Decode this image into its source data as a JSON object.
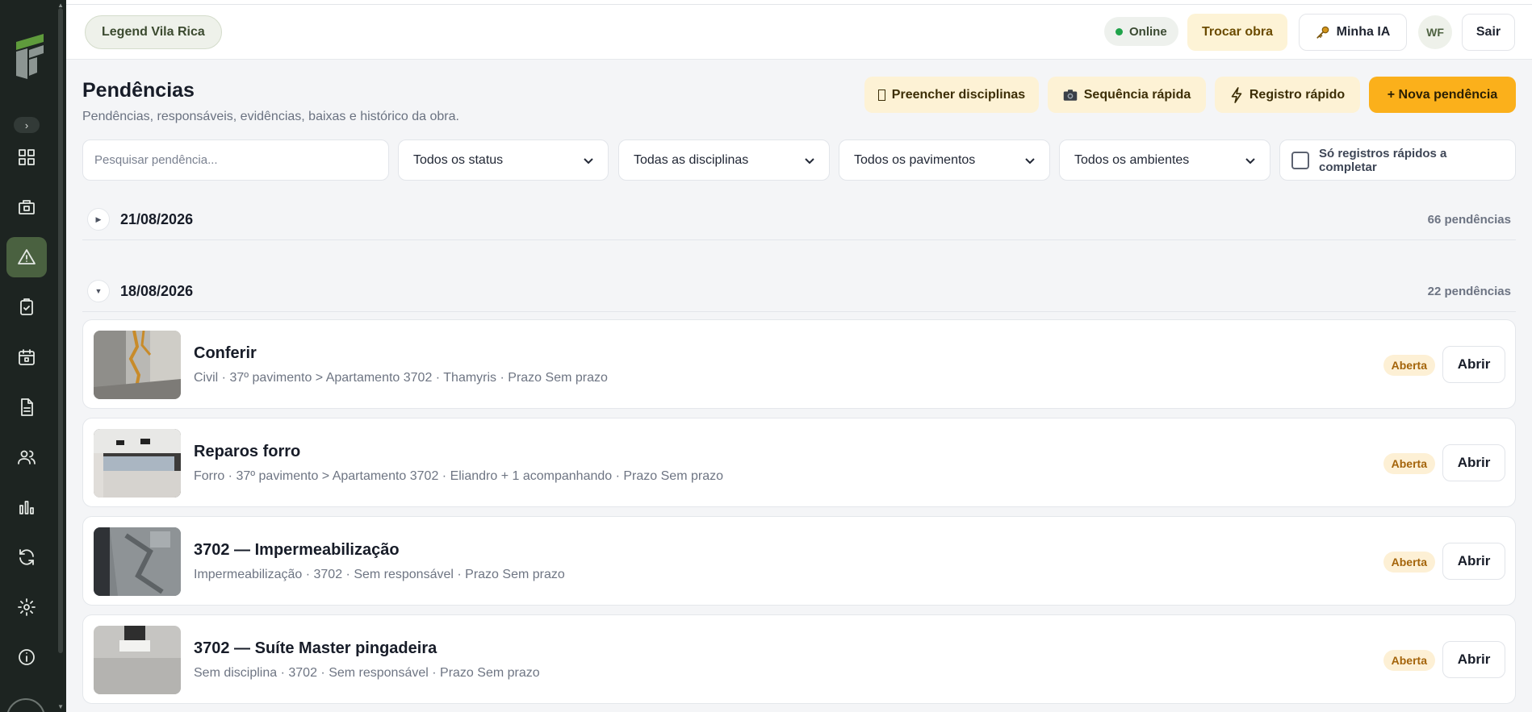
{
  "header": {
    "project": "Legend Vila Rica",
    "status": "Online",
    "switch_label": "Trocar obra",
    "ai_label": "Minha IA",
    "avatar_initials": "WF",
    "logout_label": "Sair"
  },
  "page": {
    "title": "Pendências",
    "subtitle": "Pendências, responsáveis, evidências, baixas e histórico da obra."
  },
  "actions": {
    "fill_disciplines": "Preencher disciplinas",
    "quick_sequence": "Sequência rápida",
    "quick_record": "Registro rápido",
    "new_issue": "+ Nova pendência"
  },
  "filters": {
    "search_placeholder": "Pesquisar pendência...",
    "status": "Todos os status",
    "discipline": "Todas as disciplinas",
    "floor": "Todos os pavimentos",
    "room": "Todos os ambientes",
    "quick_only": "Só registros rápidos a completar"
  },
  "groups": [
    {
      "date": "21/08/2026",
      "count": "66 pendências",
      "expanded": false
    },
    {
      "date": "18/08/2026",
      "count": "22 pendências",
      "expanded": true
    }
  ],
  "rows": [
    {
      "title": "Conferir",
      "meta": "Civil · 37º pavimento > Apartamento 3702 · Thamyris · Prazo Sem prazo",
      "status": "Aberta",
      "action": "Abrir"
    },
    {
      "title": "Reparos forro",
      "meta": "Forro · 37º pavimento > Apartamento 3702 · Eliandro + 1 acompanhando · Prazo Sem prazo",
      "status": "Aberta",
      "action": "Abrir"
    },
    {
      "title": "3702 — Impermeabilização",
      "meta": "Impermeabilização · 3702 · Sem responsável · Prazo Sem prazo",
      "status": "Aberta",
      "action": "Abrir"
    },
    {
      "title": "3702 — Suíte Master pingadeira",
      "meta": "Sem disciplina · 3702 · Sem responsável · Prazo Sem prazo",
      "status": "Aberta",
      "action": "Abrir"
    }
  ],
  "colors": {
    "sidebar": "#1d2421",
    "accent": "#fbb01b",
    "active_nav": "#4a6140",
    "badge_text": "#a4640a"
  },
  "sidebar_icons": [
    "grid-icon",
    "building-icon",
    "warning-icon",
    "clipboard-check-icon",
    "calendar-icon",
    "document-icon",
    "users-icon",
    "bar-chart-icon",
    "sync-icon",
    "gear-icon",
    "info-icon"
  ]
}
